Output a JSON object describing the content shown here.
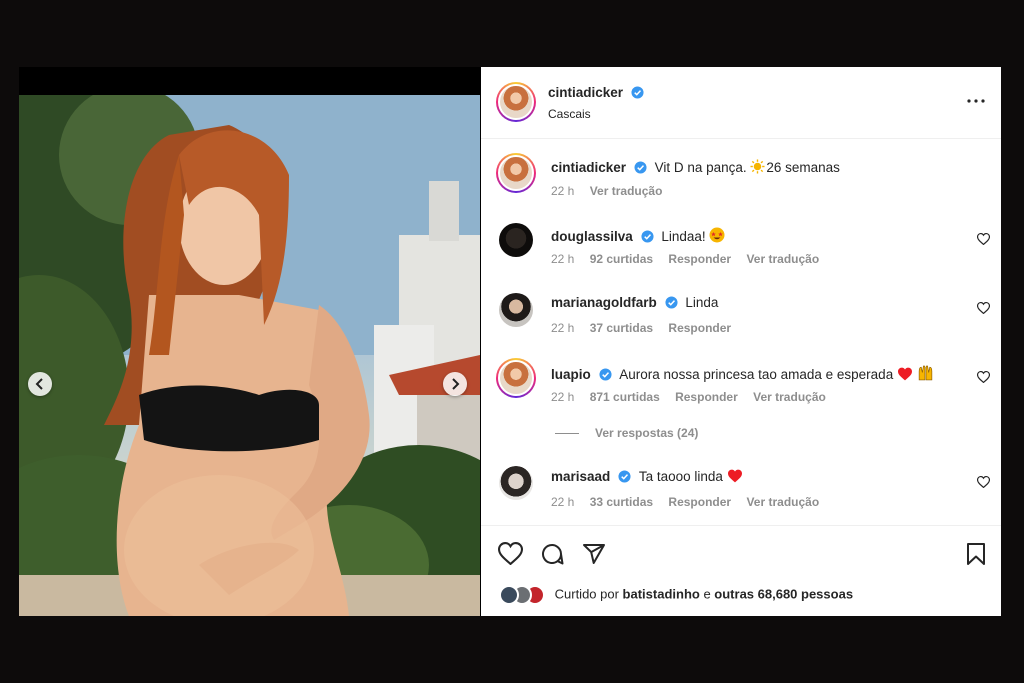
{
  "post": {
    "author": "cintiadicker",
    "location": "Cascais"
  },
  "caption": {
    "user": "cintiadicker",
    "text": "Vit D na pança. ",
    "text_after_emoji": "26 semanas",
    "time": "22 h",
    "translate": "Ver tradução"
  },
  "comments": [
    {
      "user": "douglassilva",
      "text": "Lindaa!",
      "time": "22 h",
      "likes": "92 curtidas",
      "reply": "Responder",
      "translate": "Ver tradução"
    },
    {
      "user": "marianagoldfarb",
      "text": "Linda",
      "time": "22 h",
      "likes": "37 curtidas",
      "reply": "Responder"
    },
    {
      "user": "luapio",
      "text": "Aurora nossa princesa tao amada e esperada",
      "time": "22 h",
      "likes": "871 curtidas",
      "reply": "Responder",
      "translate": "Ver tradução",
      "view_replies": "Ver respostas (24)"
    },
    {
      "user": "marisaad",
      "text": "Ta taooo linda ",
      "time": "22 h",
      "likes": "33 curtidas",
      "reply": "Responder",
      "translate": "Ver tradução"
    }
  ],
  "likes_summary": {
    "prefix": "Curtido por ",
    "user": "batistadinho",
    "middle": " e ",
    "others": "outras 68,680 pessoas"
  },
  "icons": {
    "verified": "verified-badge-icon",
    "more": "more-options-icon",
    "like": "heart-icon",
    "comment": "comment-icon",
    "share": "share-icon",
    "save": "bookmark-icon",
    "prev": "chevron-left-icon",
    "next": "chevron-right-icon"
  },
  "colors": {
    "verified": "#3897f0",
    "heart_red": "#ed1c24",
    "muted": "#8e8e8e",
    "text": "#262626"
  }
}
